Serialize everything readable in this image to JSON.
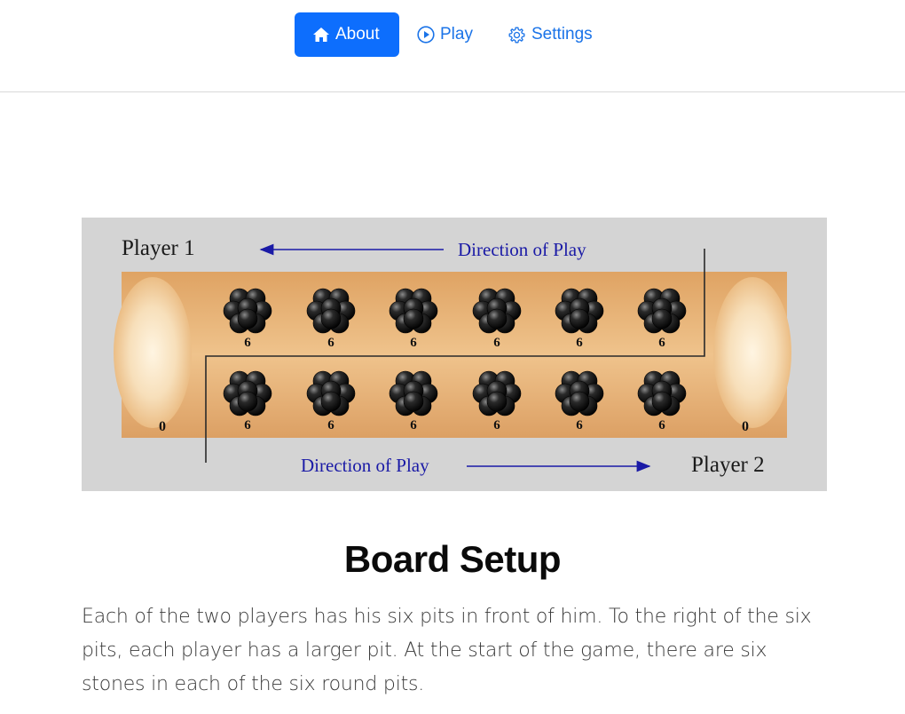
{
  "nav": {
    "items": [
      {
        "label": "About",
        "icon": "home-icon",
        "active": true
      },
      {
        "label": "Play",
        "icon": "play-circle-icon",
        "active": false
      },
      {
        "label": "Settings",
        "icon": "gear-icon",
        "active": false
      }
    ]
  },
  "board": {
    "player_top": "Player 1",
    "player_bottom": "Player 2",
    "direction_top": "Direction of Play",
    "direction_bottom": "Direction of Play",
    "pit_count_top": [
      "6",
      "6",
      "6",
      "6",
      "6",
      "6"
    ],
    "pit_count_bottom": [
      "6",
      "6",
      "6",
      "6",
      "6",
      "6"
    ],
    "store_left": "0",
    "store_right": "0"
  },
  "section": {
    "title": "Board Setup",
    "body": "Each of the two players has his six pits in front of him. To the right of the six pits, each player has a larger pit. At the start of the game, there are six stones in each of the six round pits."
  },
  "colors": {
    "accent": "#0d6efd",
    "link": "#1a73e8",
    "board_wood": "#e9b274",
    "figure_bg": "#d4d4d4",
    "direction_text": "#1a1aa6"
  }
}
